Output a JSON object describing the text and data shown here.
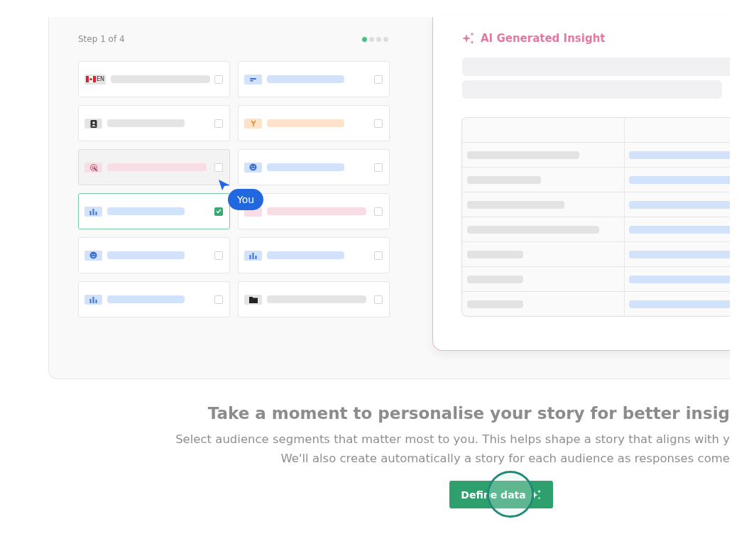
{
  "progress": {
    "label": "Step 1 of 4",
    "steps": [
      {
        "selected": true
      },
      {
        "selected": false
      },
      {
        "selected": false
      },
      {
        "selected": false
      }
    ]
  },
  "segments": [
    {
      "kind": "flag",
      "label": "EN",
      "color": "#e4e4e4",
      "checked": false,
      "hovered": false
    },
    {
      "kind": "lines",
      "color": "#d3e2fb",
      "checked": false,
      "hovered": false
    },
    {
      "kind": "badge",
      "color": "#e4e4e4",
      "checked": false,
      "hovered": false
    },
    {
      "kind": "fork",
      "color": "#fde3cc",
      "checked": false,
      "hovered": false
    },
    {
      "kind": "target",
      "color": "#f9dde4",
      "checked": false,
      "hovered": true
    },
    {
      "kind": "smiley",
      "color": "#d3e2fb",
      "checked": false,
      "hovered": false
    },
    {
      "kind": "chart",
      "color": "#d3e2fb",
      "checked": true,
      "hovered": false
    },
    {
      "kind": "blank",
      "color": "#f9dde4",
      "checked": false,
      "hovered": false
    },
    {
      "kind": "smiley",
      "color": "#d3e2fb",
      "checked": false,
      "hovered": false
    },
    {
      "kind": "chart",
      "color": "#d3e2fb",
      "checked": false,
      "hovered": false
    },
    {
      "kind": "chart",
      "color": "#d3e2fb",
      "checked": false,
      "hovered": false
    },
    {
      "kind": "folder",
      "color": "#e4e4e4",
      "checked": false,
      "hovered": false
    }
  ],
  "cursor": {
    "label": "You"
  },
  "insight": {
    "title": "AI Generated Insight"
  },
  "heading": "Take a moment to personalise your story for better insig",
  "description": [
    "Select audience segments that matter most to you. This helps shape a story that aligns with y",
    "We'll also create automatically a story for each audience as responses come"
  ],
  "button": {
    "label": "Define data"
  }
}
